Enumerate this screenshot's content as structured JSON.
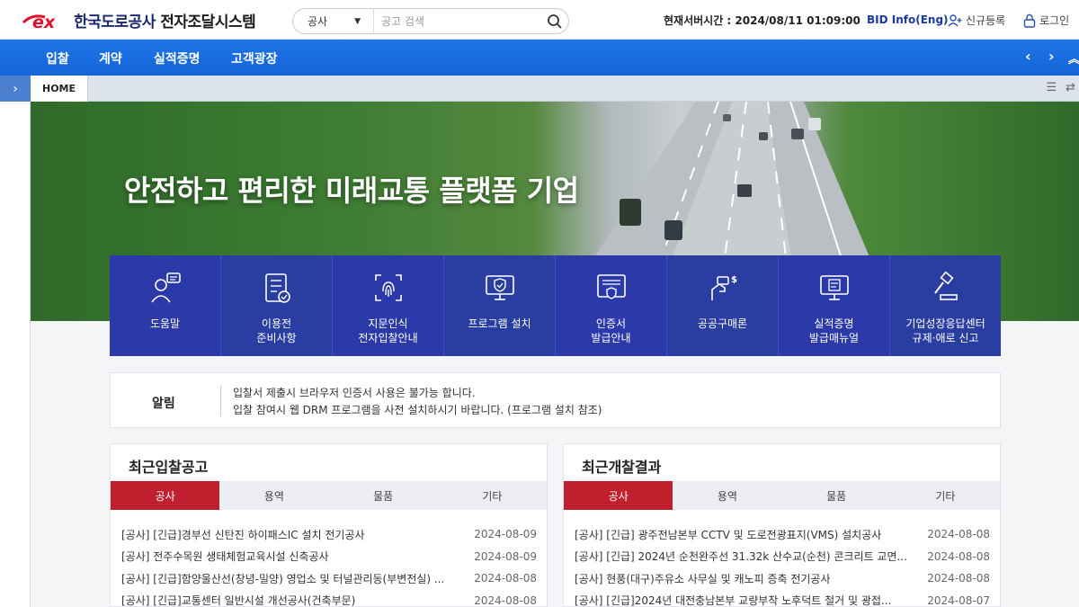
{
  "header": {
    "logo_mark": "ex",
    "logo_org": "한국도로공사",
    "logo_system": "전자조달시스템",
    "search": {
      "category": "공사",
      "placeholder": "공고 검색"
    },
    "server_time": "현재서버시간 : 2024/08/11 01:09:00",
    "eng_link": "BID Info(Eng)",
    "signup_label": "신규등록",
    "login_label": "로그인"
  },
  "nav": {
    "items": [
      "입찰",
      "계약",
      "실적증명",
      "고객광장"
    ]
  },
  "breadcrumb": {
    "home": "HOME"
  },
  "hero": {
    "title": "안전하고 편리한 미래교통 플랫폼 기업"
  },
  "quick_menu": [
    {
      "label": "도움말",
      "icon": "helpdesk-icon",
      "color": "#2b3aa8"
    },
    {
      "label": "이용전\n준비사항",
      "icon": "checklist-icon",
      "color": "#2a3ea2"
    },
    {
      "label": "지문인식\n전자입찰안내",
      "icon": "fingerprint-icon",
      "color": "#2b3aa8"
    },
    {
      "label": "프로그램 설치",
      "icon": "monitor-shield-icon",
      "color": "#2a3ea2"
    },
    {
      "label": "인증서\n발급안내",
      "icon": "certificate-icon",
      "color": "#2b3aa8"
    },
    {
      "label": "공공구매론",
      "icon": "hand-coin-icon",
      "color": "#2a3ea2"
    },
    {
      "label": "실적증명\n발급매뉴얼",
      "icon": "monitor-doc-icon",
      "color": "#2b3aa8"
    },
    {
      "label": "기업성장응답센터\n규제·애로 신고",
      "icon": "gavel-icon",
      "color": "#2a3ea2"
    }
  ],
  "notice": {
    "title": "알림",
    "lines": [
      "입찰서 제출시 브라우저 인증서 사용은 불가능 합니다.",
      "입찰 참여시 웹 DRM 프로그램을 사전 설치하시기 바랍니다. (프로그램 설치 참조)"
    ]
  },
  "bids": {
    "title": "최근입찰공고",
    "tabs": [
      "공사",
      "용역",
      "물품",
      "기타"
    ],
    "active_tab": 0,
    "rows": [
      {
        "title": "[공사] [긴급]경부선 신탄진 하이패스IC 설치 전기공사",
        "date": "2024-08-09"
      },
      {
        "title": "[공사] 전주수목원 생태체험교육시설 신축공사",
        "date": "2024-08-09"
      },
      {
        "title": "[공사] [긴급]함양울산선(창녕-밀양) 영업소 및 터널관리동(부변전실) ...",
        "date": "2024-08-08"
      },
      {
        "title": "[공사] [긴급]교통센터 일반시설 개선공사(건축부문)",
        "date": "2024-08-08"
      }
    ]
  },
  "results": {
    "title": "최근개찰결과",
    "tabs": [
      "공사",
      "용역",
      "물품",
      "기타"
    ],
    "active_tab": 0,
    "rows": [
      {
        "title": "[공사] [긴급] 광주전남본부 CCTV 및 도로전광표지(VMS) 설치공사",
        "date": "2024-08-08"
      },
      {
        "title": "[공사] [긴급] 2024년 순천완주선 31.32k 산수교(순천) 콘크리트 교면...",
        "date": "2024-08-08"
      },
      {
        "title": "[공사] 현풍(대구)주유소 사무실 및 캐노피 증축 전기공사",
        "date": "2024-08-08"
      },
      {
        "title": "[공사] [긴급]2024년 대전충남본부 교량부착 노후덕트 철거 및 광접...",
        "date": "2024-08-07"
      }
    ]
  },
  "colors": {
    "nav_blue": "#1565d8",
    "tab_active": "#c0202d",
    "quick_blue": "#2b3aa8",
    "logo_red": "#e30f2b"
  }
}
